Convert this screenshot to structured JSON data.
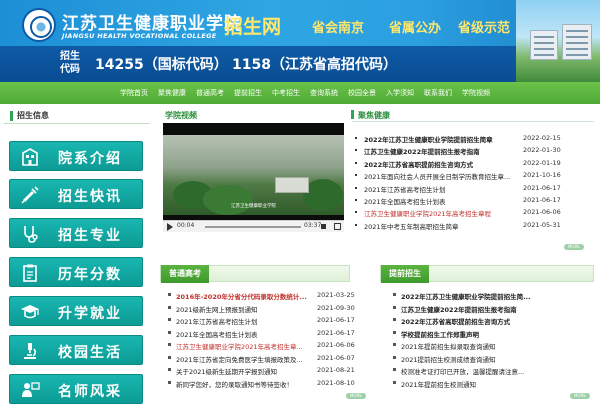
{
  "header": {
    "school_cn": "江苏卫生健康职业学院",
    "school_en": "JIANGSU HEALTH VOCATIONAL COLLEGE",
    "site_name": "招生网",
    "slogans": [
      "省会南京",
      "省属公办",
      "省级示范"
    ],
    "code_label": "招生代码",
    "national_code": "14255（国标代码）",
    "province_code": "1158（江苏省高招代码）",
    "logo_icon": "college-seal-logo"
  },
  "nav": {
    "items": [
      "学院首页",
      "聚焦健康",
      "普通高考",
      "提前招生",
      "中考招生",
      "查询系统",
      "校园全景",
      "入学须知",
      "联系我们",
      "学院视频"
    ]
  },
  "sidebar": {
    "title": "招生信息",
    "items": [
      {
        "label": "院系介绍",
        "icon": "building-icon"
      },
      {
        "label": "招生快讯",
        "icon": "syringe-icon"
      },
      {
        "label": "招生专业",
        "icon": "stethoscope-icon"
      },
      {
        "label": "历年分数",
        "icon": "clipboard-icon"
      },
      {
        "label": "升学就业",
        "icon": "graduate-icon"
      },
      {
        "label": "校园生活",
        "icon": "microscope-icon"
      },
      {
        "label": "名师风采",
        "icon": "teacher-icon"
      }
    ]
  },
  "video": {
    "title": "学院视频",
    "current_time": "00:04",
    "duration": "03:37",
    "caption": "江苏卫生健康职业学院",
    "progress": 0.02
  },
  "focus": {
    "title": "聚焦健康",
    "more": "MORE",
    "items": [
      {
        "title": "2022年江苏卫生健康职业学院提前招生简章",
        "date": "2022-02-15",
        "style": "bold"
      },
      {
        "title": "江苏卫生健康2022年提前招生报考指南",
        "date": "2022-01-30",
        "style": "bold"
      },
      {
        "title": "2022年江苏省高职提前招生咨询方式",
        "date": "2022-01-19",
        "style": "bold"
      },
      {
        "title": "2021年面向社会人员开展全日制学历教育招生章...",
        "date": "2021-10-16",
        "style": "normal"
      },
      {
        "title": "2021年江苏省高考招生计划",
        "date": "2021-06-17",
        "style": "normal"
      },
      {
        "title": "2021年全国高考招生计划表",
        "date": "2021-06-17",
        "style": "normal"
      },
      {
        "title": "江苏卫生健康职业学院2021年高考招生章程",
        "date": "2021-06-06",
        "style": "red"
      },
      {
        "title": "2021年中考五年制高职招生简章",
        "date": "2021-05-31",
        "style": "normal"
      }
    ]
  },
  "general": {
    "title": "普通高考",
    "more": "MORE",
    "items": [
      {
        "title": "2016年-2020年分省分代码录取分数统计...",
        "date": "2021-03-25",
        "style": "redbold"
      },
      {
        "title": "2021级新生网上预报到通知",
        "date": "2021-09-30",
        "style": "normal"
      },
      {
        "title": "2021年江苏省高考招生计划",
        "date": "2021-06-17",
        "style": "normal"
      },
      {
        "title": "2021年全国高考招生计划表",
        "date": "2021-06-17",
        "style": "normal"
      },
      {
        "title": "江苏卫生健康职业学院2021年高考招生章...",
        "date": "2021-06-06",
        "style": "red"
      },
      {
        "title": "2021年江苏省定向免费医学生填报政策及...",
        "date": "2021-06-07",
        "style": "normal"
      },
      {
        "title": "关于2021级新生延期开学报到通知",
        "date": "2021-08-21",
        "style": "normal"
      },
      {
        "title": "新同学您好，您的录取通知书等待签收！",
        "date": "2021-08-10",
        "style": "normal"
      }
    ]
  },
  "early": {
    "title": "提前招生",
    "more": "MORE",
    "items": [
      {
        "title": "2022年江苏卫生健康职业学院提前招生简...",
        "style": "bold"
      },
      {
        "title": "江苏卫生健康2022年提前招生报考指南",
        "style": "bold"
      },
      {
        "title": "2022年江苏省高职提前招生咨询方式",
        "style": "bold"
      },
      {
        "title": "学校提前招生工作郑重声明",
        "style": "bold"
      },
      {
        "title": "2021年提前招生拟录取查询通知",
        "style": "normal"
      },
      {
        "title": "2021提前招生校测成绩查询通知",
        "style": "normal"
      },
      {
        "title": "校测准考证打印已开放，温馨提醒请注意...",
        "style": "normal"
      },
      {
        "title": "2021年提前招生校测通知",
        "style": "normal"
      }
    ]
  },
  "colors": {
    "header_blue": "#2fa6e3",
    "nav_green": "#4da935",
    "sidebar_teal": "#0d9b95",
    "accent_yellow": "#ffe76a",
    "link_red": "#c0302b"
  }
}
